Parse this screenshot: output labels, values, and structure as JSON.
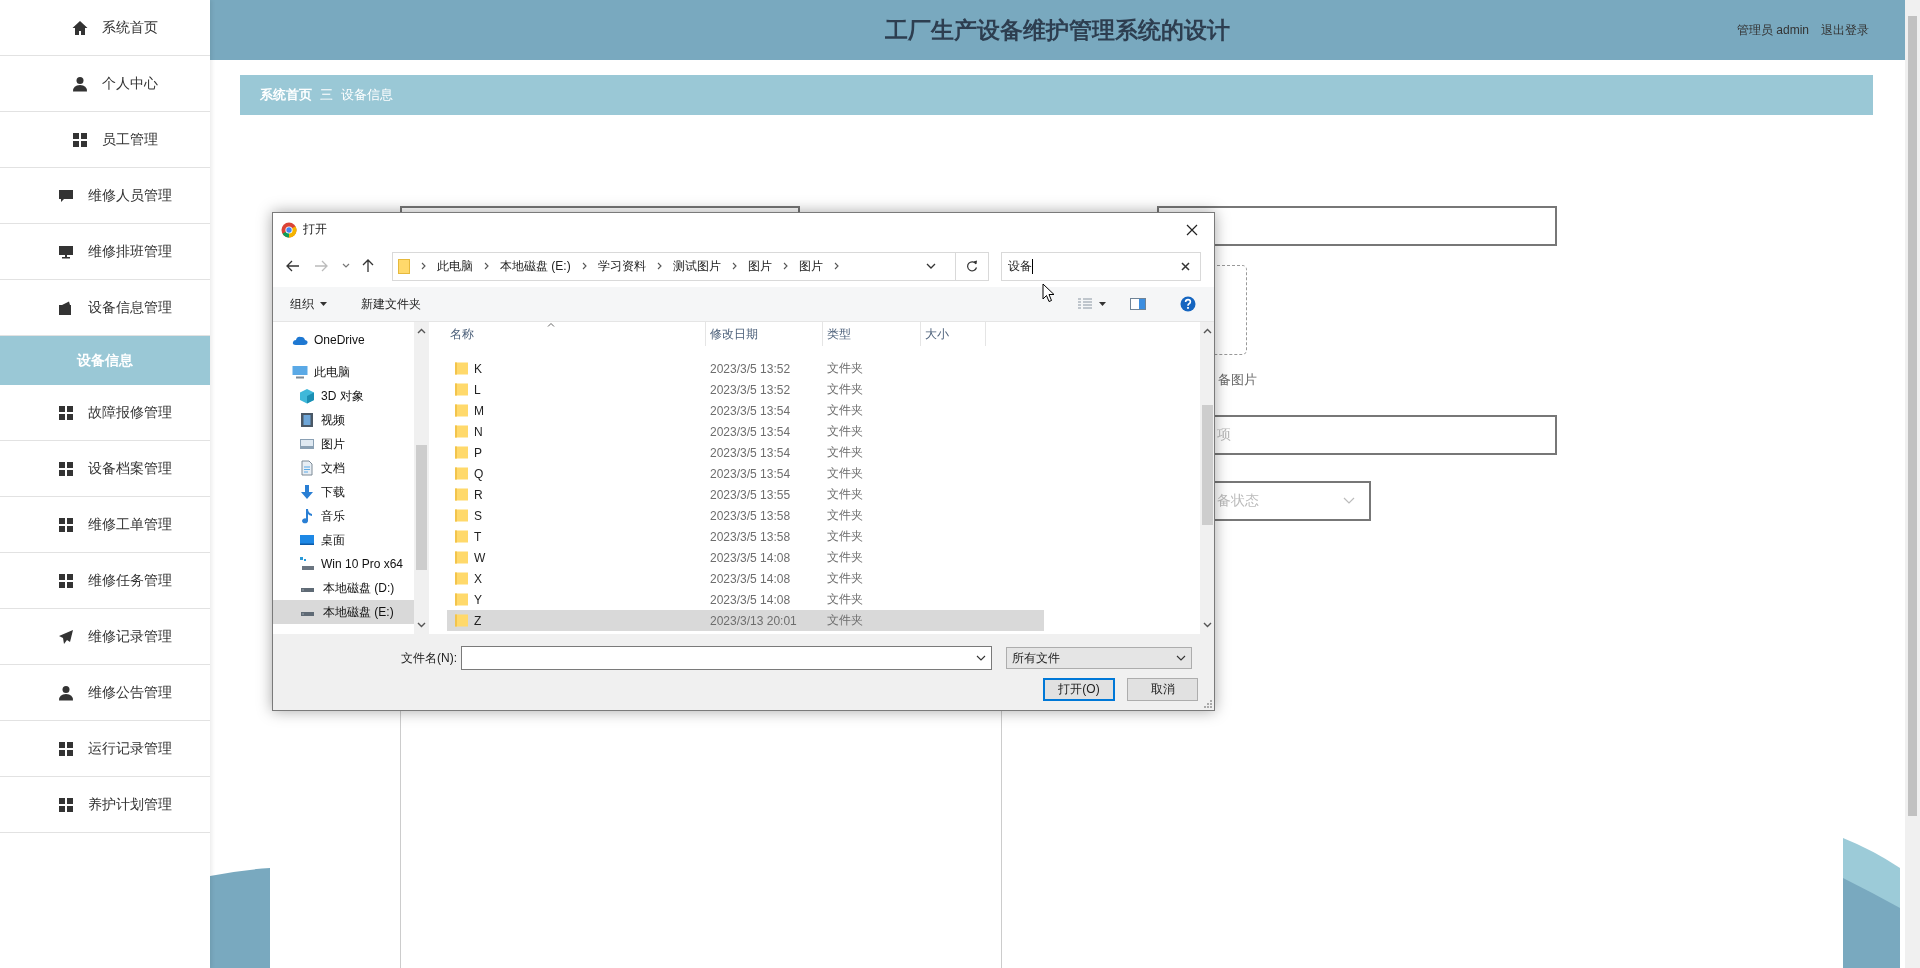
{
  "sidebar": {
    "items": [
      {
        "kind": "home",
        "label": "系统首页",
        "selected": false
      },
      {
        "kind": "user",
        "label": "个人中心",
        "selected": false
      },
      {
        "kind": "grid",
        "label": "员工管理",
        "selected": false
      },
      {
        "kind": "chat",
        "label": "维修人员管理",
        "selected": false
      },
      {
        "kind": "monitor",
        "label": "维修排班管理",
        "selected": false
      },
      {
        "kind": "wallet",
        "label": "设备信息管理",
        "selected": false
      },
      {
        "kind": "sub",
        "label": "设备信息",
        "selected": true
      },
      {
        "kind": "grid",
        "label": "故障报修管理",
        "selected": false
      },
      {
        "kind": "grid",
        "label": "设备档案管理",
        "selected": false
      },
      {
        "kind": "grid",
        "label": "维修工单管理",
        "selected": false
      },
      {
        "kind": "grid",
        "label": "维修任务管理",
        "selected": false
      },
      {
        "kind": "plane",
        "label": "维修记录管理",
        "selected": false
      },
      {
        "kind": "user",
        "label": "维修公告管理",
        "selected": false
      },
      {
        "kind": "grid",
        "label": "运行记录管理",
        "selected": false
      },
      {
        "kind": "grid",
        "label": "养护计划管理",
        "selected": false
      }
    ]
  },
  "header": {
    "title": "工厂生产设备维护管理系统的设计",
    "user": "管理员 admin",
    "logout": "退出登录"
  },
  "breadcrumb": {
    "items": [
      "系统首页",
      "设备信息"
    ],
    "separator": "三"
  },
  "form": {
    "fields": [
      {
        "kind": "input"
      },
      {
        "kind": "upload",
        "label": "备图片"
      },
      {
        "kind": "input",
        "placeholder": "项"
      },
      {
        "kind": "select",
        "placeholder": "备状态"
      }
    ]
  },
  "dialog": {
    "title": "打开",
    "path": [
      "此电脑",
      "本地磁盘 (E:)",
      "学习资料",
      "测试图片",
      "图片",
      "图片"
    ],
    "search": {
      "value": "设备"
    },
    "toolbar": {
      "organize": "组织",
      "new_folder": "新建文件夹"
    },
    "nav": [
      {
        "kind": "cloud",
        "label": "OneDrive",
        "selected": false
      },
      {
        "kind": "pc",
        "label": "此电脑",
        "selected": false,
        "children": [
          {
            "kind": "cube",
            "label": "3D 对象",
            "selected": false
          },
          {
            "kind": "video",
            "label": "视频",
            "selected": false
          },
          {
            "kind": "picture",
            "label": "图片",
            "selected": false
          },
          {
            "kind": "document",
            "label": "文档",
            "selected": false
          },
          {
            "kind": "download",
            "label": "下载",
            "selected": false
          },
          {
            "kind": "music",
            "label": "音乐",
            "selected": false
          },
          {
            "kind": "desktop",
            "label": "桌面",
            "selected": false
          },
          {
            "kind": "netdrive",
            "label": "Win 10 Pro x64",
            "selected": false
          },
          {
            "kind": "drive",
            "label": "本地磁盘 (D:)",
            "selected": false
          },
          {
            "kind": "drive",
            "label": "本地磁盘 (E:)",
            "selected": true
          }
        ]
      }
    ],
    "columns": [
      "名称",
      "修改日期",
      "类型",
      "大小"
    ],
    "files": [
      {
        "name": "K",
        "modified": "2023/3/5 13:52",
        "type": "文件夹",
        "selected": false
      },
      {
        "name": "L",
        "modified": "2023/3/5 13:52",
        "type": "文件夹",
        "selected": false
      },
      {
        "name": "M",
        "modified": "2023/3/5 13:54",
        "type": "文件夹",
        "selected": false
      },
      {
        "name": "N",
        "modified": "2023/3/5 13:54",
        "type": "文件夹",
        "selected": false
      },
      {
        "name": "P",
        "modified": "2023/3/5 13:54",
        "type": "文件夹",
        "selected": false
      },
      {
        "name": "Q",
        "modified": "2023/3/5 13:54",
        "type": "文件夹",
        "selected": false
      },
      {
        "name": "R",
        "modified": "2023/3/5 13:55",
        "type": "文件夹",
        "selected": false
      },
      {
        "name": "S",
        "modified": "2023/3/5 13:58",
        "type": "文件夹",
        "selected": false
      },
      {
        "name": "T",
        "modified": "2023/3/5 13:58",
        "type": "文件夹",
        "selected": false
      },
      {
        "name": "W",
        "modified": "2023/3/5 14:08",
        "type": "文件夹",
        "selected": false
      },
      {
        "name": "X",
        "modified": "2023/3/5 14:08",
        "type": "文件夹",
        "selected": false
      },
      {
        "name": "Y",
        "modified": "2023/3/5 14:08",
        "type": "文件夹",
        "selected": false
      },
      {
        "name": "Z",
        "modified": "2023/3/13 20:01",
        "type": "文件夹",
        "selected": true
      }
    ],
    "file_name": {
      "label": "文件名(N):"
    },
    "filter": {
      "value": "所有文件"
    },
    "buttons": [
      {
        "label": "打开(O)",
        "default": true
      },
      {
        "label": "取消",
        "default": false
      }
    ]
  }
}
